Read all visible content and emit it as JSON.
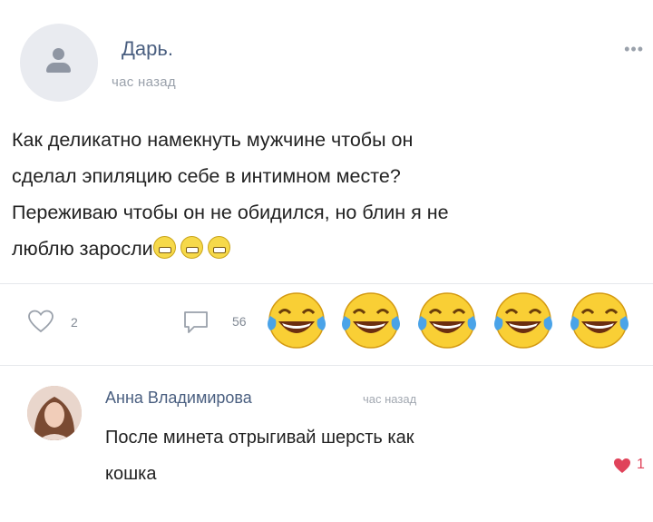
{
  "post": {
    "author": "Дарь.",
    "time": "час назад",
    "text_lines": [
      "Как деликатно намекнуть мужчине чтобы он",
      "сделал эпиляцию себе в интимном месте?",
      "Переживаю чтобы он не обидился, но блин я не",
      "люблю заросли"
    ],
    "likes": "2",
    "comments": "56",
    "more_icon": "more-icon",
    "inline_emoji": "grimacing-face",
    "reaction_emoji": "face-with-tears-of-joy",
    "reaction_emoji_count": 5
  },
  "comment": {
    "author": "Анна Владимирова",
    "time": "час назад",
    "text_lines": [
      "После минета отрыгивай шерсть как",
      "кошка"
    ],
    "likes": "1"
  },
  "colors": {
    "link": "#4a5f80",
    "muted": "#9aa1ab",
    "heart": "#e0435a"
  }
}
